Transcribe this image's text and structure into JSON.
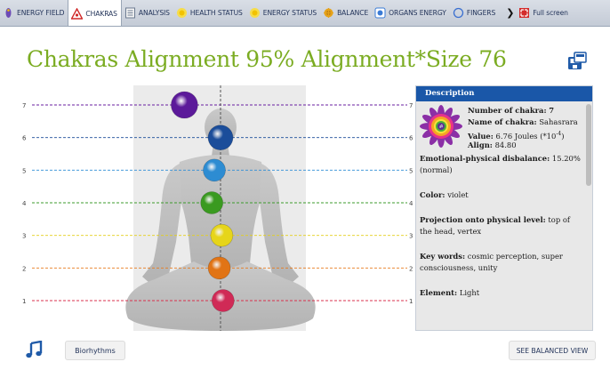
{
  "tabs": [
    {
      "label": "ENERGY FIELD",
      "icon": "energy-field-icon",
      "active": false
    },
    {
      "label": "CHAKRAS",
      "icon": "chakras-icon",
      "active": true
    },
    {
      "label": "ANALYSIS",
      "icon": "analysis-icon",
      "active": false
    },
    {
      "label": "HEALTH STATUS",
      "icon": "health-status-icon",
      "active": false
    },
    {
      "label": "ENERGY STATUS",
      "icon": "energy-status-icon",
      "active": false
    },
    {
      "label": "BALANCE",
      "icon": "balance-icon",
      "active": false
    },
    {
      "label": "ORGANS ENERGY",
      "icon": "organs-energy-icon",
      "active": false
    },
    {
      "label": "FINGERS",
      "icon": "fingers-icon",
      "active": false
    },
    {
      "label": "Full screen",
      "icon": "full-screen-icon",
      "active": false
    }
  ],
  "page": {
    "title": "Chakras Alignment 95% Alignment*Size 76"
  },
  "chart": {
    "levels": [
      "1",
      "2",
      "3",
      "4",
      "5",
      "6",
      "7"
    ],
    "level_colors": [
      "#d8314d",
      "#e77a1d",
      "#e4cf1a",
      "#3d9b2c",
      "#2f8dd6",
      "#1b4d9a",
      "#6a1fa0"
    ],
    "chakras": [
      {
        "level": 1,
        "offset": 0.1,
        "color": "#d02a56"
      },
      {
        "level": 2,
        "offset": -0.05,
        "color": "#e17415"
      },
      {
        "level": 3,
        "offset": 0.05,
        "color": "#e6d51a"
      },
      {
        "level": 4,
        "offset": -0.35,
        "color": "#3a9a20"
      },
      {
        "level": 5,
        "offset": -0.25,
        "color": "#2d8cd2"
      },
      {
        "level": 6,
        "offset": 0.0,
        "color": "#1b4d9a"
      },
      {
        "level": 7,
        "offset": -1.45,
        "color": "#5c1a9a"
      }
    ]
  },
  "description": {
    "header": "Description",
    "number_label": "Number of chakra:",
    "number_value": "7",
    "name_label": "Name of chakra:",
    "name_value": "Sahasrara",
    "value_label": "Value:",
    "value_value": "6.76 Joules (*10",
    "value_exp": "-4",
    "value_close": ")",
    "align_label": "Align:",
    "align_value": "84.80",
    "emo_label": "Emotional-physical disbalance:",
    "emo_value": "15.20%",
    "emo_note": "(normal)",
    "color_label": "Color:",
    "color_value": "violet",
    "proj_label": "Projection onto physical level:",
    "proj_value": "top of the head, vertex",
    "key_label": "Key words:",
    "key_value": "cosmic perception, super consciousness, unity",
    "element_label": "Element:",
    "element_value": "Light"
  },
  "bottom": {
    "biorhythms_label": "Biorhythms",
    "balanced_label": "SEE BALANCED VIEW"
  }
}
